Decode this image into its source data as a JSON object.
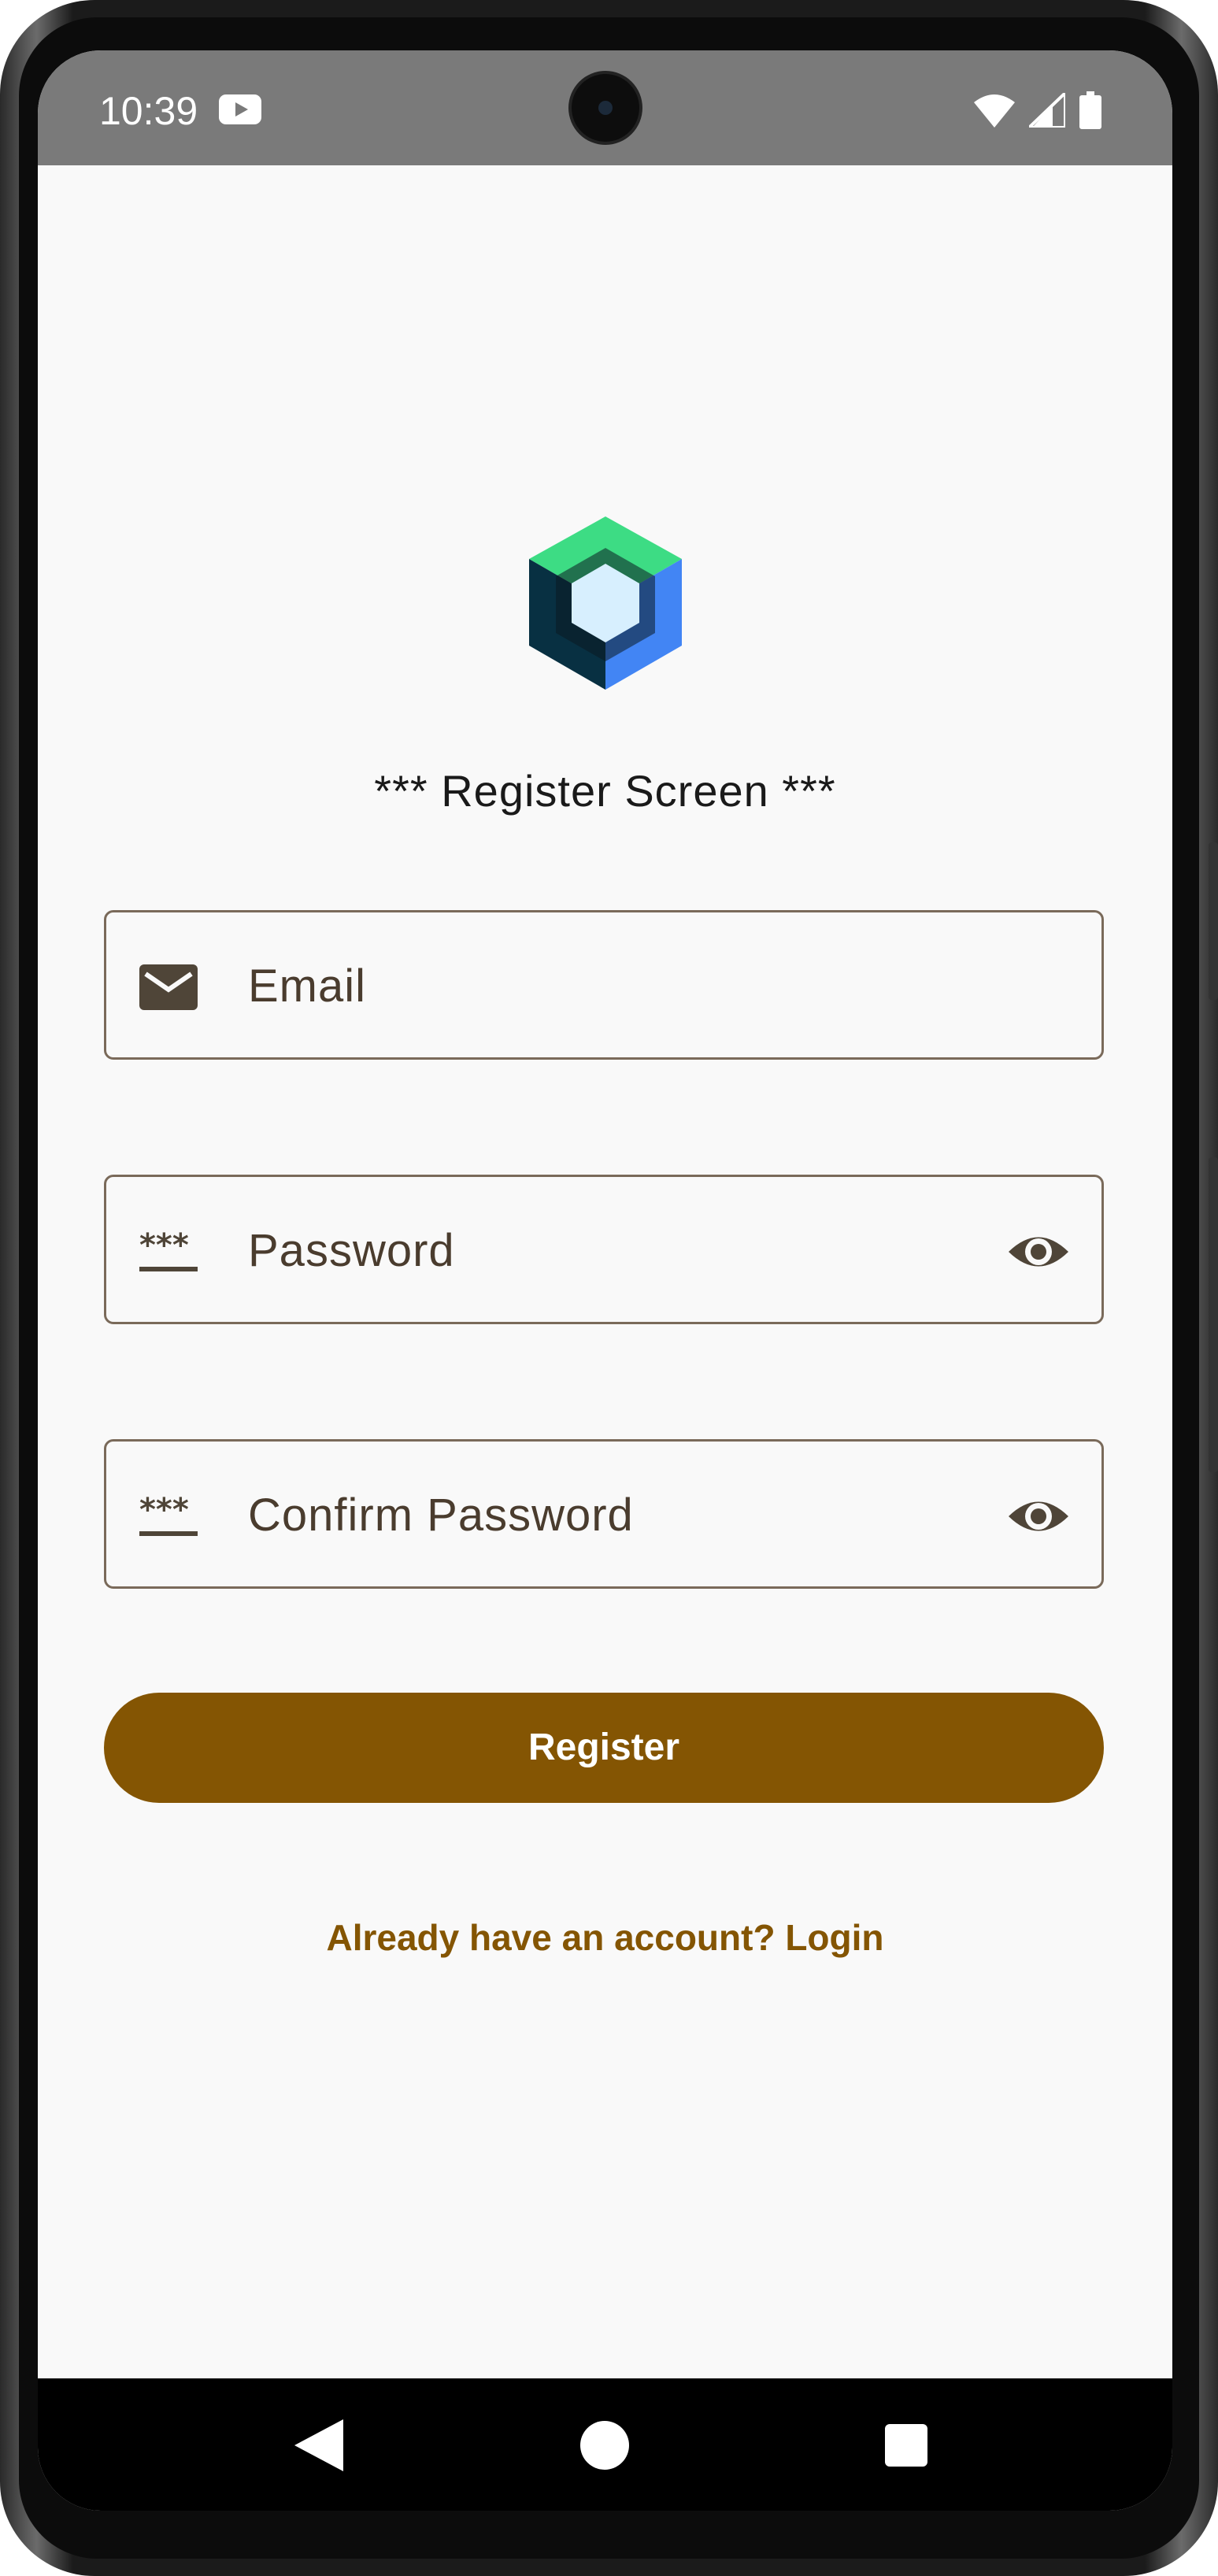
{
  "status_bar": {
    "time": "10:39",
    "icons": [
      "youtube-notification-icon",
      "wifi-icon",
      "cellular-signal-icon",
      "battery-icon"
    ]
  },
  "app_logo": "jetpack-compose-logo",
  "title": "*** Register Screen ***",
  "fields": {
    "email": {
      "label": "Email",
      "leading_icon": "mail-icon"
    },
    "password": {
      "label": "Password",
      "leading_icon": "password-icon",
      "trailing_icon": "visibility-icon"
    },
    "confirm_password": {
      "label": "Confirm Password",
      "leading_icon": "password-icon",
      "trailing_icon": "visibility-icon"
    }
  },
  "register_button": "Register",
  "login_link": "Already have an account? Login",
  "navigation": [
    "back-icon",
    "home-icon",
    "recents-icon"
  ],
  "colors": {
    "primary": "#845503",
    "outline": "#7a6a5a",
    "on_surface_variant": "#4a3c2e",
    "background": "#f9f9f9",
    "status_bar": "#7a7a7a"
  }
}
